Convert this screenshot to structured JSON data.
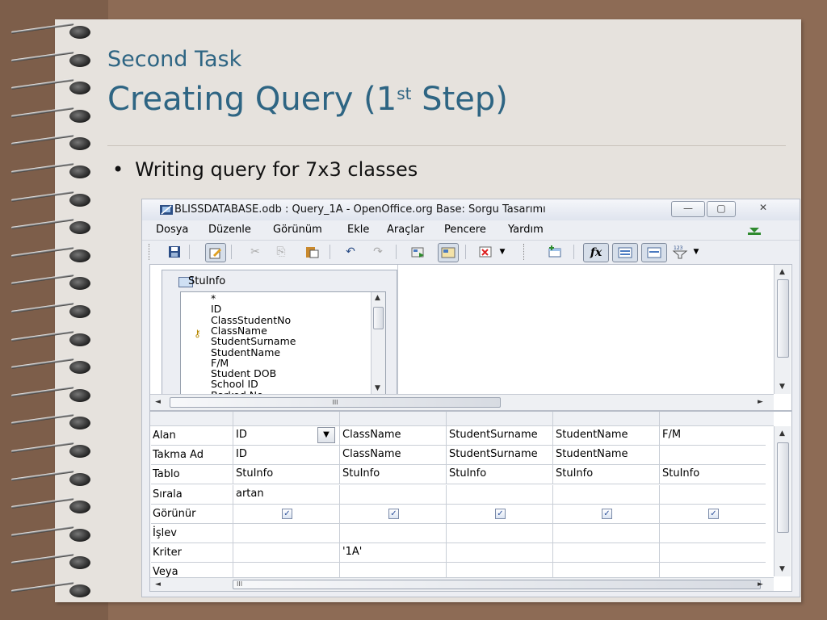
{
  "slide": {
    "subtitle": "Second Task",
    "title_main": "Creating Query (1",
    "title_sup": "st",
    "title_end": " Step)",
    "bullet_symbol": "•",
    "bullet": "Writing query for 7x3 classes"
  },
  "window": {
    "title": "BLISSDATABASE.odb : Query_1A - OpenOffice.org Base: Sorgu Tasarımı",
    "controls": {
      "minimize": "—",
      "maximize": "▢",
      "close": "✕"
    }
  },
  "menu": {
    "items": [
      {
        "label": "Dosya"
      },
      {
        "label": "Düzenle"
      },
      {
        "label": "Görünüm"
      },
      {
        "label": "Ekle"
      },
      {
        "label": "Araçlar"
      },
      {
        "label": "Pencere"
      },
      {
        "label": "Yardım"
      }
    ]
  },
  "table_window": {
    "name": "StuInfo",
    "fields": [
      "*",
      "ID",
      "ClassStudentNo",
      "ClassName",
      "StudentSurname",
      "StudentName",
      "F/M",
      "Student DOB",
      "School ID",
      "Barkod No"
    ]
  },
  "grid": {
    "row_labels": [
      "Alan",
      "Takma Ad",
      "Tablo",
      "Sırala",
      "Görünür",
      "İşlev",
      "Kriter",
      "Veya"
    ],
    "columns": [
      {
        "alan": "ID",
        "takma_ad": "ID",
        "tablo": "StuInfo",
        "sirala": "artan",
        "gorunur": true,
        "islev": "",
        "kriter": "",
        "veya": ""
      },
      {
        "alan": "ClassName",
        "takma_ad": "ClassName",
        "tablo": "StuInfo",
        "sirala": "",
        "gorunur": true,
        "islev": "",
        "kriter": "'1A'",
        "veya": ""
      },
      {
        "alan": "StudentSurname",
        "takma_ad": "StudentSurname",
        "tablo": "StuInfo",
        "sirala": "",
        "gorunur": true,
        "islev": "",
        "kriter": "",
        "veya": ""
      },
      {
        "alan": "StudentName",
        "takma_ad": "StudentName",
        "tablo": "StuInfo",
        "sirala": "",
        "gorunur": true,
        "islev": "",
        "kriter": "",
        "veya": ""
      },
      {
        "alan": "F/M",
        "takma_ad": "",
        "tablo": "StuInfo",
        "sirala": "",
        "gorunur": true,
        "islev": "",
        "kriter": "",
        "veya": ""
      }
    ],
    "scroll_grip": "III"
  },
  "colors": {
    "title_blue": "#2e6583",
    "background_brown": "#8d6b55",
    "paper": "#e6e2dd"
  }
}
